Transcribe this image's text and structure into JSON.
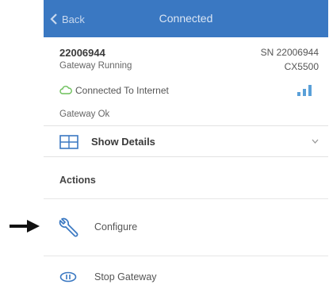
{
  "nav": {
    "back_label": "Back",
    "title": "Connected",
    "bg_color": "#3a78c2"
  },
  "gateway": {
    "id": "22006944",
    "serial": "SN 22006944",
    "status": "Gateway Running",
    "model": "CX5500",
    "connection": "Connected To Internet",
    "health": "Gateway Ok",
    "icons": [
      "cloud-icon",
      "signal-icon"
    ]
  },
  "details": {
    "label": "Show Details",
    "icons": [
      "details-icon",
      "chevron-down-icon"
    ]
  },
  "actions": {
    "header": "Actions",
    "items": [
      {
        "label": "Configure",
        "icon": "wrench-icon"
      },
      {
        "label": "Stop Gateway",
        "icon": "stop-gateway-icon"
      }
    ]
  }
}
